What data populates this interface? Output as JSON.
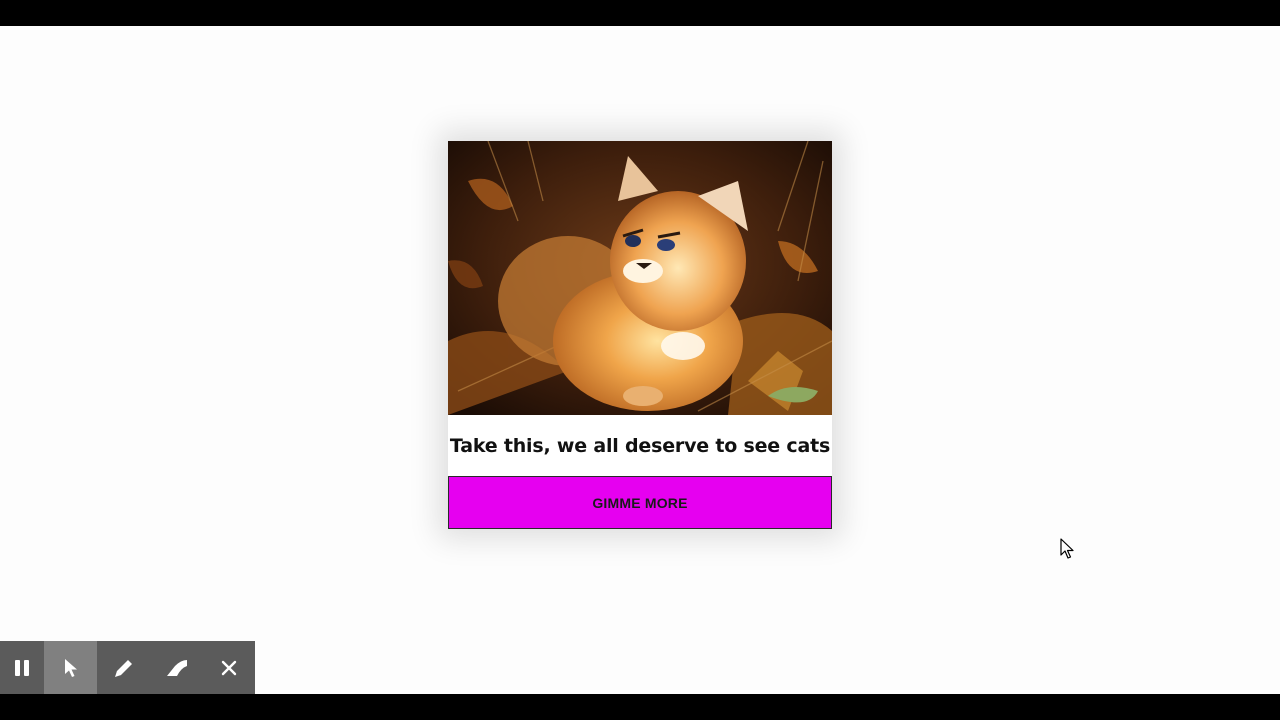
{
  "card": {
    "image_alt": "caracal kitten",
    "caption": "Take this, we all deserve to see cats",
    "button_label": "GIMME MORE",
    "button_color": "#e600f0"
  },
  "toolbar": {
    "tools": [
      {
        "name": "pause-icon"
      },
      {
        "name": "pointer-icon",
        "selected": true
      },
      {
        "name": "pen-icon"
      },
      {
        "name": "eraser-icon"
      },
      {
        "name": "close-icon"
      }
    ]
  }
}
